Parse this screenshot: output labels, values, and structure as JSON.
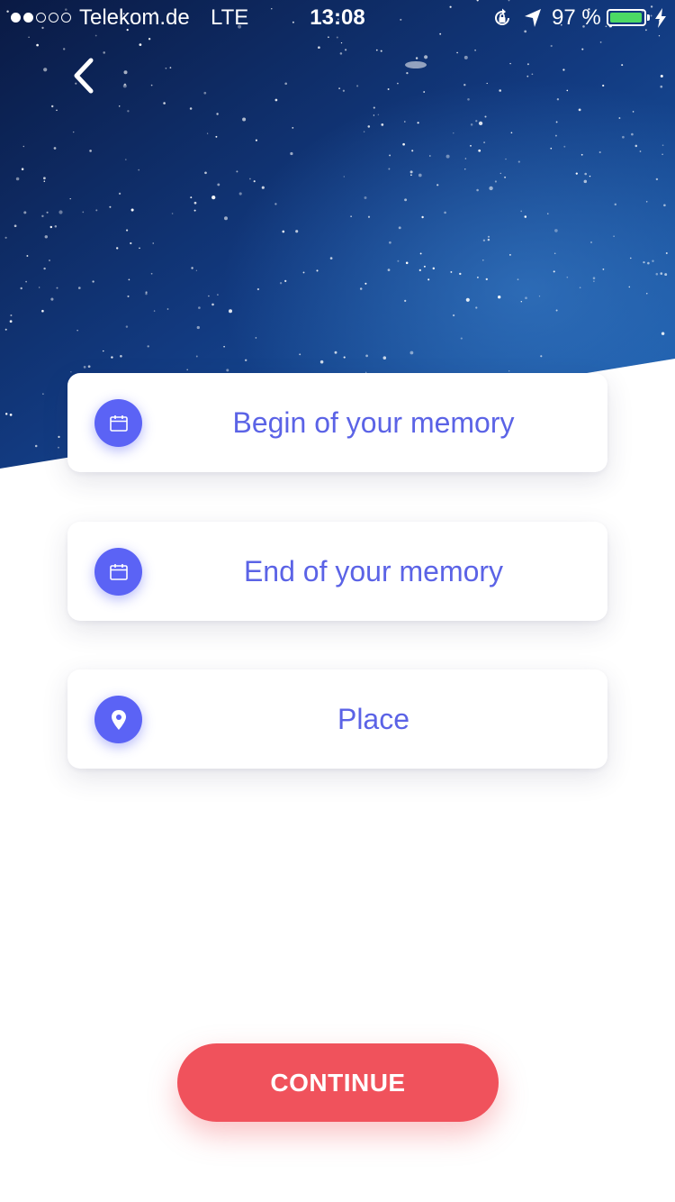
{
  "status_bar": {
    "signal_dots_filled": 2,
    "signal_dots_total": 5,
    "carrier": "Telekom.de",
    "network": "LTE",
    "time": "13:08",
    "battery_percent_label": "97 %",
    "battery_level": 0.97,
    "battery_color": "#4cd964"
  },
  "navigation": {
    "back_icon": "chevron-left-icon"
  },
  "form": {
    "fields": [
      {
        "label": "Begin of your memory",
        "icon": "calendar-icon"
      },
      {
        "label": "End of your memory",
        "icon": "calendar-icon"
      },
      {
        "label": "Place",
        "icon": "map-pin-icon"
      }
    ]
  },
  "actions": {
    "continue_label": "CONTINUE"
  },
  "theme": {
    "accent": "#5b63f5",
    "label_color": "#5b63e6",
    "primary_button": "#f0525c",
    "sky_dark": "#0b1f4d",
    "sky_light": "#1b5fae"
  }
}
